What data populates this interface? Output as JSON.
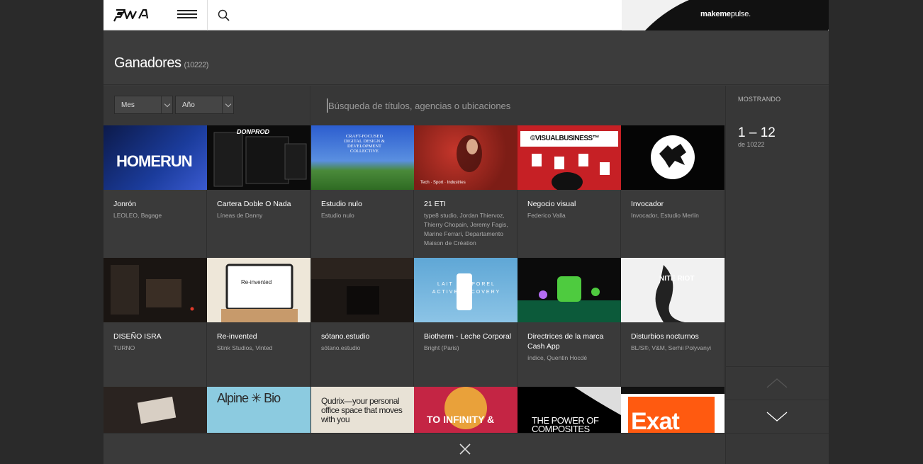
{
  "topbar": {
    "logo_text": "FWA",
    "ad_brand_bold": "makeme",
    "ad_brand_light": "pulse."
  },
  "header": {
    "title": "Ganadores",
    "count": "(10222)"
  },
  "filters": {
    "month_label": "Mes",
    "year_label": "Año",
    "search_placeholder": "Búsqueda de títulos, agencias o ubicaciones"
  },
  "sidebar": {
    "showing_label": "MOSTRANDO",
    "range": "1 – 12",
    "range_of": "de 10222"
  },
  "cards": [
    {
      "title": "Jonrón",
      "subtitle": "LEOLEO, Bagage",
      "thumb_text": "HOMERUN"
    },
    {
      "title": "Cartera Doble O Nada",
      "subtitle": "Líneas de Danny",
      "thumb_text": "DONPROD"
    },
    {
      "title": "Estudio nulo",
      "subtitle": "Estudio nulo",
      "thumb_text": "CRAFT-FOCUSED DIGITAL DESIGN & DEVELOPMENT COLLECTIVE"
    },
    {
      "title": "21 ETI",
      "subtitle": "type8 studio, Jordan Thiervoz, Thierry Chopain, Jeremy Fagis, Marine Ferrari, Departamento Maison de Création",
      "thumb_text": "Tech · Sport · Industries"
    },
    {
      "title": "Negocio visual",
      "subtitle": "Federico Valla",
      "thumb_text": "©VISUALBUSINESS™"
    },
    {
      "title": "Invocador",
      "subtitle": "Invocador, Estudio Merlín",
      "thumb_text": ""
    },
    {
      "title": "DISEÑO ISRA",
      "subtitle": "TURNO",
      "thumb_text": ""
    },
    {
      "title": "Re-invented",
      "subtitle": "Stink Studios, Vinted",
      "thumb_text": "Re-invented"
    },
    {
      "title": "sótano.estudio",
      "subtitle": "sótano.estudio",
      "thumb_text": ""
    },
    {
      "title": "Biotherm - Leche Corporal",
      "subtitle": "Bright (Paris)",
      "thumb_text": "LAIT CORPOREL ACTIVE RECOVERY"
    },
    {
      "title": "Directrices de la marca Cash App",
      "subtitle": "índice, Quentin Hocdé",
      "thumb_text": ""
    },
    {
      "title": "Disturbios nocturnos",
      "subtitle": "BL/S®, V&M, Serhii Polyvanyi",
      "thumb_text": "NITE RIOT"
    }
  ],
  "row3_thumbs": [
    "",
    "Alpine ✳ Bio",
    "Qudrix—your personal office space that moves with you",
    "TO INFINITY &",
    "THE POWER OF COMPOSITES",
    "Exat"
  ],
  "nav": {
    "up": "chevron-up",
    "down": "chevron-down",
    "close": "close"
  }
}
